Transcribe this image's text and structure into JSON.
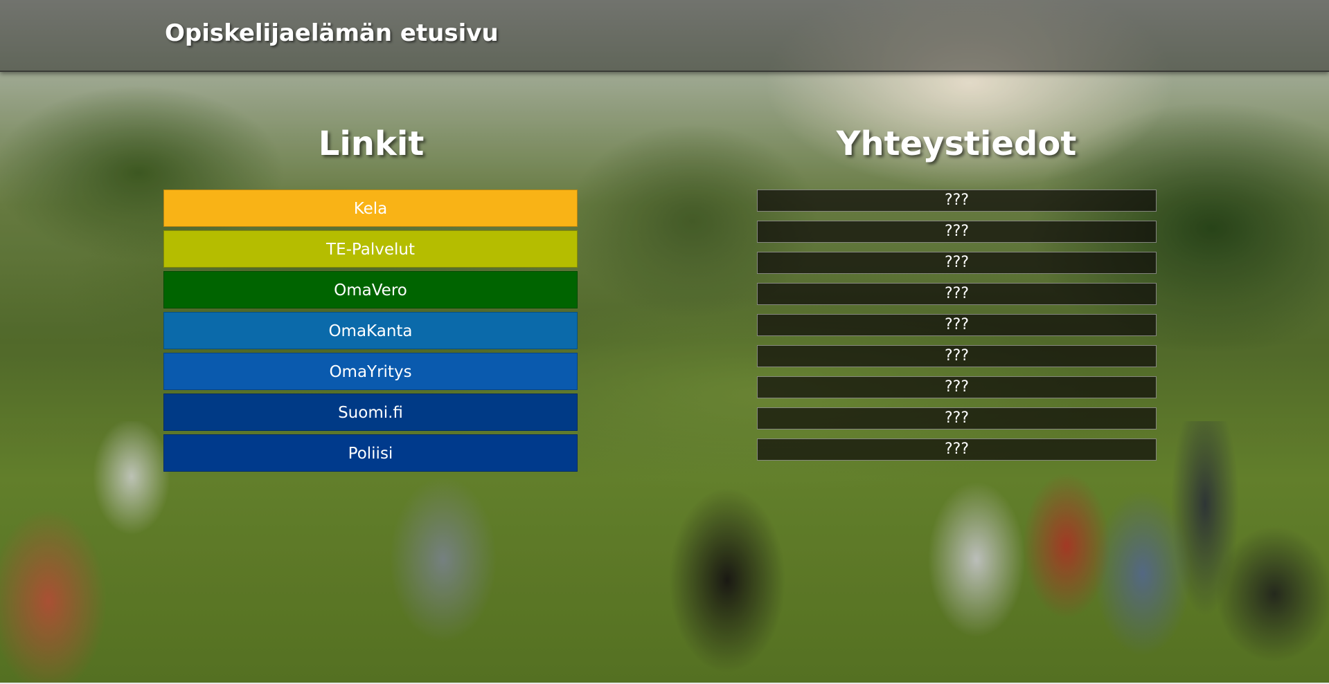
{
  "header": {
    "title": "Opiskelijaelämän etusivu"
  },
  "links": {
    "title": "Linkit",
    "items": [
      {
        "label": "Kela",
        "color": "#f9b316"
      },
      {
        "label": "TE-Palvelut",
        "color": "#b5bd00"
      },
      {
        "label": "OmaVero",
        "color": "#006400"
      },
      {
        "label": "OmaKanta",
        "color": "#0b6aaa"
      },
      {
        "label": "OmaYritys",
        "color": "#0a5aae"
      },
      {
        "label": "Suomi.fi",
        "color": "#003a86"
      },
      {
        "label": "Poliisi",
        "color": "#003a8c"
      }
    ]
  },
  "contacts": {
    "title": "Yhteystiedot",
    "items": [
      "???",
      "???",
      "???",
      "???",
      "???",
      "???",
      "???",
      "???",
      "???"
    ]
  }
}
